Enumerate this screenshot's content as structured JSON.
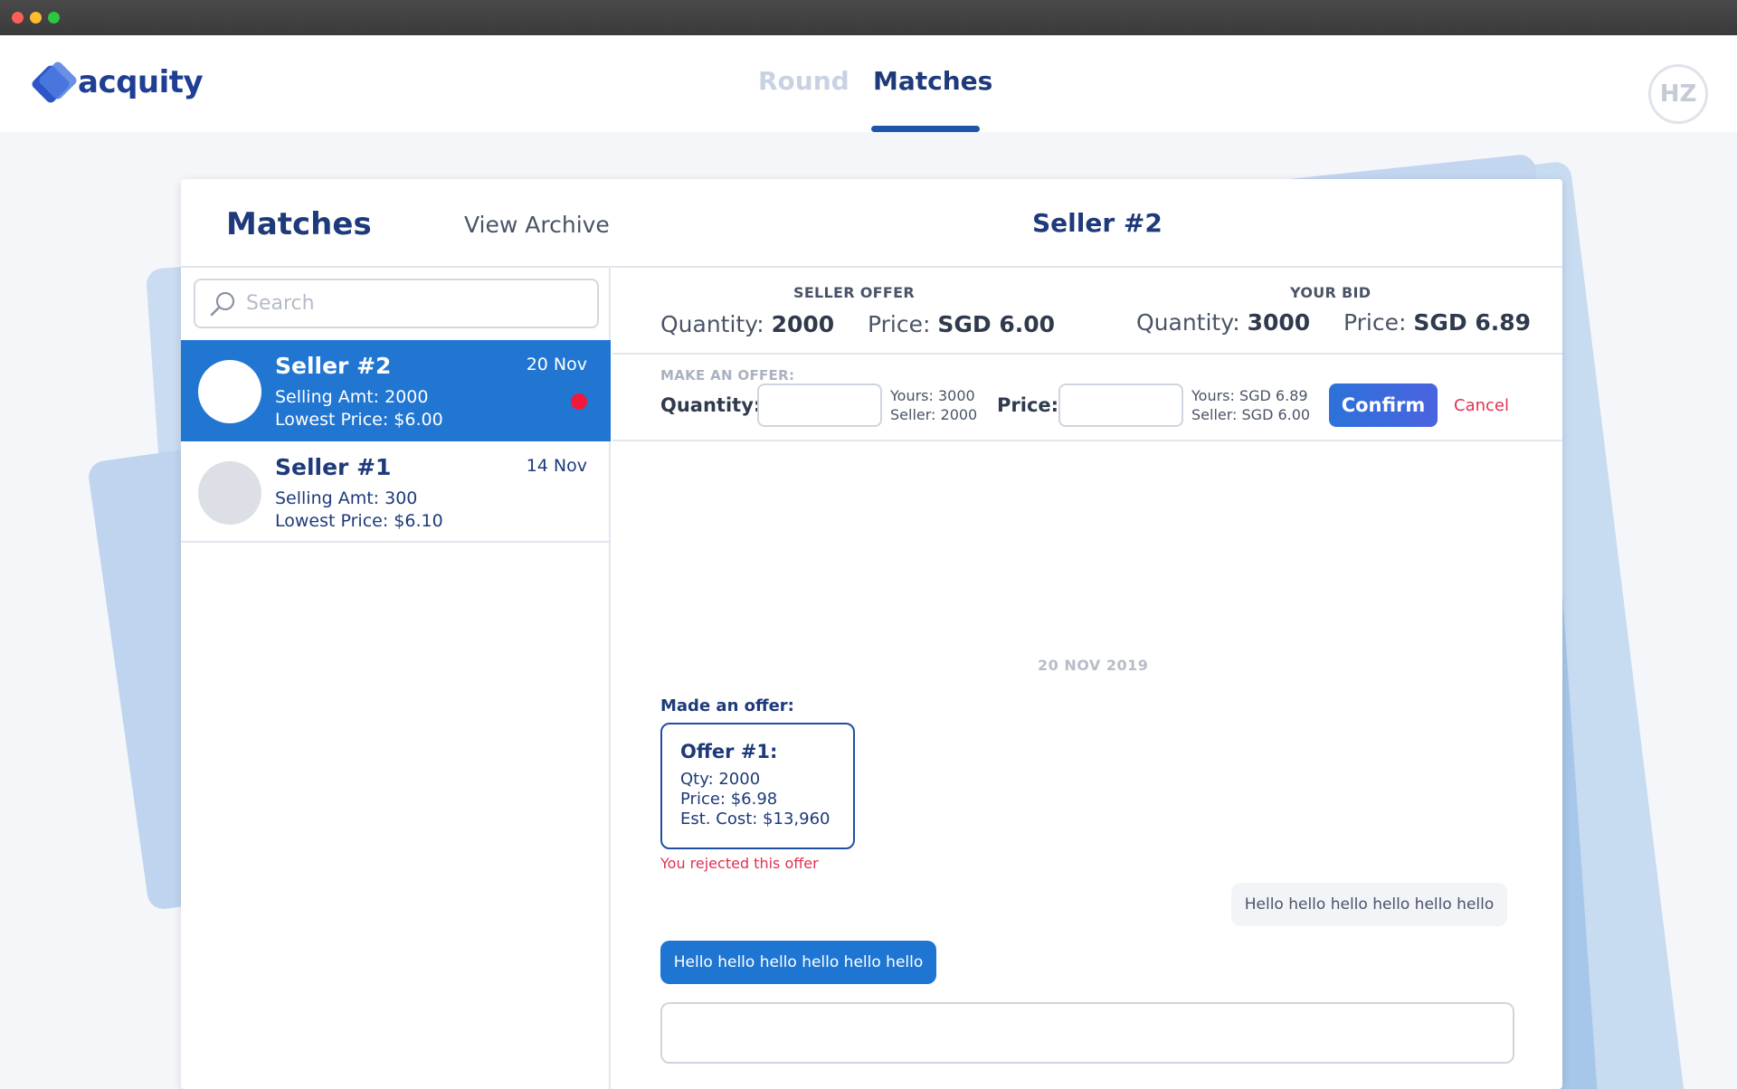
{
  "app": {
    "logo_text": "acquity",
    "nav": {
      "round": "Round",
      "matches": "Matches"
    },
    "user_initials": "HZ"
  },
  "panel": {
    "title": "Matches",
    "view_archive": "View Archive",
    "active_seller": "Seller #2"
  },
  "sidebar": {
    "search_placeholder": "Search",
    "items": [
      {
        "name": "Seller #2",
        "date": "20 Nov",
        "selling": "Selling Amt: 2000",
        "lowest": "Lowest Price: $6.00",
        "unread": true
      },
      {
        "name": "Seller #1",
        "date": "14 Nov",
        "selling": "Selling Amt: 300",
        "lowest": "Lowest Price: $6.10",
        "unread": false
      }
    ]
  },
  "offer_summary": {
    "seller_offer_label": "SELLER OFFER",
    "your_bid_label": "YOUR BID",
    "quantity_label": "Quantity:",
    "price_label": "Price:",
    "seller_quantity": "2000",
    "seller_price": "SGD 6.00",
    "bid_quantity": "3000",
    "bid_price": "SGD 6.89"
  },
  "make_offer": {
    "label": "MAKE AN OFFER:",
    "quantity_label": "Quantity:",
    "price_label": "Price:",
    "quantity_yours": "Yours: 3000",
    "quantity_seller": "Seller: 2000",
    "price_yours": "Yours: SGD 6.89",
    "price_seller": "Seller: SGD 6.00",
    "confirm": "Confirm",
    "cancel": "Cancel"
  },
  "chat": {
    "date": "20 NOV 2019",
    "made_offer_label": "Made an offer:",
    "offer": {
      "title": "Offer #1:",
      "qty": "Qty: 2000",
      "price": "Price: $6.98",
      "est_cost": "Est. Cost: $13,960"
    },
    "rejected_text": "You rejected this offer",
    "incoming_message": "Hello hello hello hello hello hello",
    "outgoing_message": "Hello hello hello hello hello hello",
    "input_placeholder": ""
  }
}
